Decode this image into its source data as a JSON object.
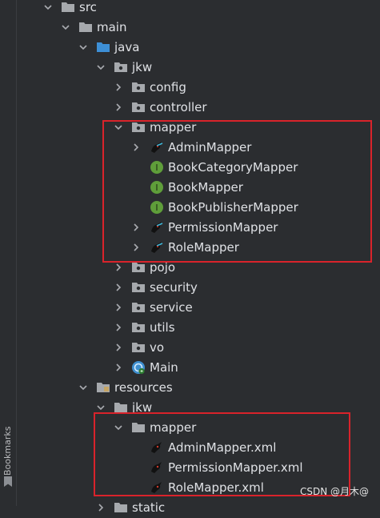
{
  "gutter": {
    "label": "Bookmarks"
  },
  "tree": {
    "src": "src",
    "main": "main",
    "java": "java",
    "jkw": "jkw",
    "config": "config",
    "controller": "controller",
    "mapper": "mapper",
    "adminMapper": "AdminMapper",
    "bookCategoryMapper": "BookCategoryMapper",
    "bookMapper": "BookMapper",
    "bookPublisherMapper": "BookPublisherMapper",
    "permissionMapper": "PermissionMapper",
    "roleMapper": "RoleMapper",
    "pojo": "pojo",
    "security": "security",
    "service": "service",
    "utils": "utils",
    "vo": "vo",
    "main_class": "Main",
    "resources": "resources",
    "res_jkw": "jkw",
    "res_mapper": "mapper",
    "adminMapperXml": "AdminMapper.xml",
    "permissionMapperXml": "PermissionMapper.xml",
    "roleMapperXml": "RoleMapper.xml",
    "static": "static"
  },
  "interface_letter": "I",
  "watermark": "CSDN @月木@",
  "colors": {
    "background": "#2b2d30",
    "text": "#dfe1e5",
    "arrow": "#a9abb0",
    "folder": "#a6a9ad",
    "source_folder": "#3d8fd6",
    "interface": "#5f9e3a",
    "highlight": "#d9232b"
  }
}
